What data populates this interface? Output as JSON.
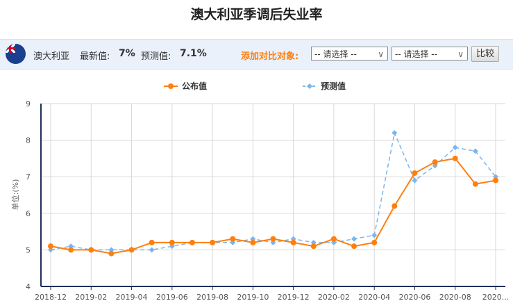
{
  "header": {
    "title": "澳大利亚季调后失业率"
  },
  "info": {
    "country": "澳大利亚",
    "latest_label": "最新值:",
    "latest_value": "7%",
    "forecast_label": "预测值:",
    "forecast_value": "7.1%",
    "compare_label": "添加对比对象:",
    "select1": "-- 请选择 --",
    "select2": "-- 请选择 --",
    "compare_button": "比较"
  },
  "colors": {
    "actual": "#ff7f0e",
    "forecast": "#7cb5ec",
    "axis": "#1f2d5a"
  },
  "chart_data": {
    "type": "line",
    "title": "澳大利亚季调后失业率",
    "ylabel": "单位:(%)",
    "ylim": [
      4,
      9
    ],
    "yticks": [
      "4",
      "5",
      "6",
      "7",
      "8",
      "9"
    ],
    "x": [
      "2018-12",
      "2019-01",
      "2019-02",
      "2019-03",
      "2019-04",
      "2019-05",
      "2019-06",
      "2019-07",
      "2019-08",
      "2019-09",
      "2019-10",
      "2019-11",
      "2019-12",
      "2020-01",
      "2020-02",
      "2020-03",
      "2020-04",
      "2020-05",
      "2020-06",
      "2020-07",
      "2020-08",
      "2020-09",
      "2020-10"
    ],
    "xtick_labels": [
      "2018-12",
      "2019-02",
      "2019-04",
      "2019-06",
      "2019-08",
      "2019-10",
      "2019-12",
      "2020-02",
      "2020-04",
      "2020-06",
      "2020-08",
      "2020..."
    ],
    "legend": "top",
    "grid": true,
    "series": [
      {
        "name": "公布值",
        "values": [
          5.1,
          5.0,
          5.0,
          4.9,
          5.0,
          5.2,
          5.2,
          5.2,
          5.2,
          5.3,
          5.2,
          5.3,
          5.2,
          5.1,
          5.3,
          5.1,
          5.2,
          6.2,
          7.1,
          7.4,
          7.5,
          6.8,
          6.9
        ]
      },
      {
        "name": "预测值",
        "values": [
          5.0,
          5.1,
          5.0,
          5.0,
          5.0,
          5.0,
          5.1,
          5.2,
          5.2,
          5.2,
          5.3,
          5.2,
          5.3,
          5.2,
          5.2,
          5.3,
          5.4,
          8.2,
          6.9,
          7.3,
          7.8,
          7.7,
          7.0
        ]
      }
    ]
  }
}
